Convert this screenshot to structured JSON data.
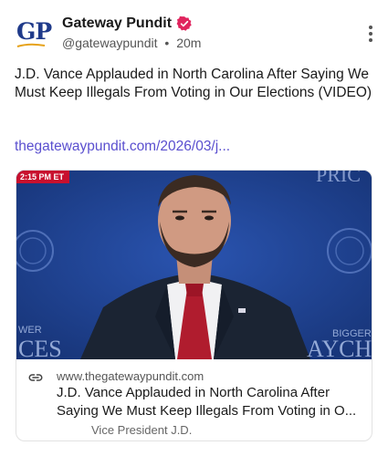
{
  "account": {
    "logo_text": "GP",
    "name": "Gateway Pundit",
    "verified": true,
    "handle": "@gatewaypundit",
    "separator": "•",
    "time": "20m"
  },
  "post": {
    "text": "J.D. Vance Applauded in North Carolina After Saying We Must Keep Illegals From Voting in Our Elections (VIDEO)",
    "link": "thegatewaypundit.com/2026/03/j..."
  },
  "card": {
    "broadcast_time": "2:15 PM ET",
    "backdrop_text_right_top": "PRIC",
    "backdrop_text_left": "WER",
    "backdrop_text_left2": "CES",
    "backdrop_text_right": "BIGGER",
    "backdrop_text_right2": "AYCHE",
    "domain": "www.thegatewaypundit.com",
    "title_line1": "J.D. Vance Applauded in North Carolina After",
    "title_line2": "Saying We Must Keep Illegals From Voting in O...",
    "caption": "Vice President J.D."
  },
  "colors": {
    "link": "#5a4fcf",
    "verified_badge": "#e0245e",
    "logo": "#1f3a8a",
    "backdrop": "#1e3f8f",
    "tie": "#b01c2e"
  },
  "icons": {
    "verified": "verified-badge-icon",
    "more": "more-vertical-icon",
    "link": "link-icon"
  }
}
